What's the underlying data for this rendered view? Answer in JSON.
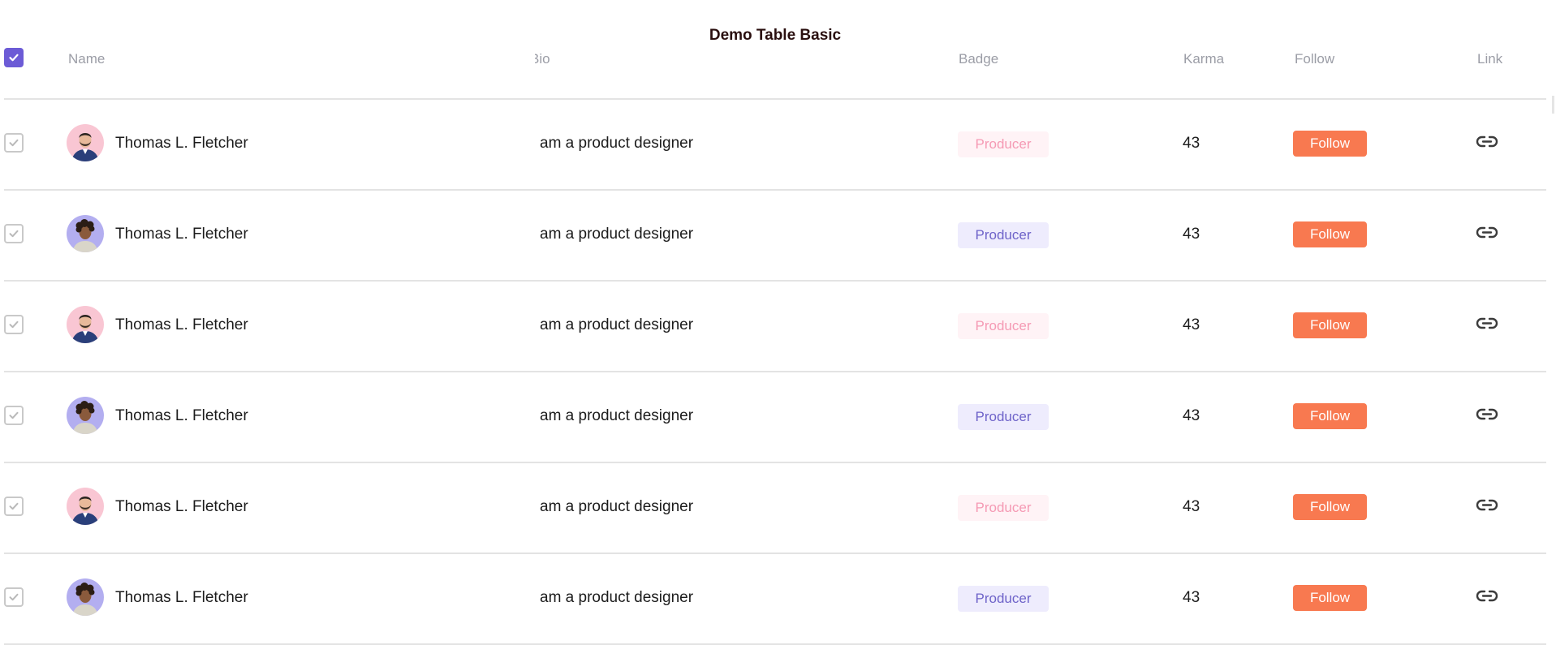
{
  "title": "Demo Table Basic",
  "columns": {
    "name": "Name",
    "bio": "Bio",
    "badge": "Badge",
    "karma": "Karma",
    "follow": "Follow",
    "link": "Link"
  },
  "rows": [
    {
      "name": "Thomas L. Fletcher",
      "bio": "am a product designer",
      "badge": "Producer",
      "badge_style": "pink",
      "karma": "43",
      "follow_label": "Follow",
      "avatar": "man-beard-pink",
      "checked": true
    },
    {
      "name": "Thomas L. Fletcher",
      "bio": "am a product designer",
      "badge": "Producer",
      "badge_style": "purple",
      "karma": "43",
      "follow_label": "Follow",
      "avatar": "man-curly-purple",
      "checked": true
    },
    {
      "name": "Thomas L. Fletcher",
      "bio": "am a product designer",
      "badge": "Producer",
      "badge_style": "pink",
      "karma": "43",
      "follow_label": "Follow",
      "avatar": "man-beard-pink",
      "checked": true
    },
    {
      "name": "Thomas L. Fletcher",
      "bio": "am a product designer",
      "badge": "Producer",
      "badge_style": "purple",
      "karma": "43",
      "follow_label": "Follow",
      "avatar": "man-curly-purple",
      "checked": true
    },
    {
      "name": "Thomas L. Fletcher",
      "bio": "am a product designer",
      "badge": "Producer",
      "badge_style": "pink",
      "karma": "43",
      "follow_label": "Follow",
      "avatar": "man-beard-pink",
      "checked": true
    },
    {
      "name": "Thomas L. Fletcher",
      "bio": "am a product designer",
      "badge": "Producer",
      "badge_style": "purple",
      "karma": "43",
      "follow_label": "Follow",
      "avatar": "man-curly-purple",
      "checked": true
    }
  ],
  "colors": {
    "accent": "#6c5bd6",
    "follow_button": "#f87950",
    "badge_pink_bg": "#fff3f6",
    "badge_pink_text": "#f59ab4",
    "badge_purple_bg": "#eeecfd",
    "badge_purple_text": "#6e63c9"
  },
  "icons": {
    "header_check": "check-icon",
    "row_check": "check-icon",
    "link": "link-icon"
  }
}
